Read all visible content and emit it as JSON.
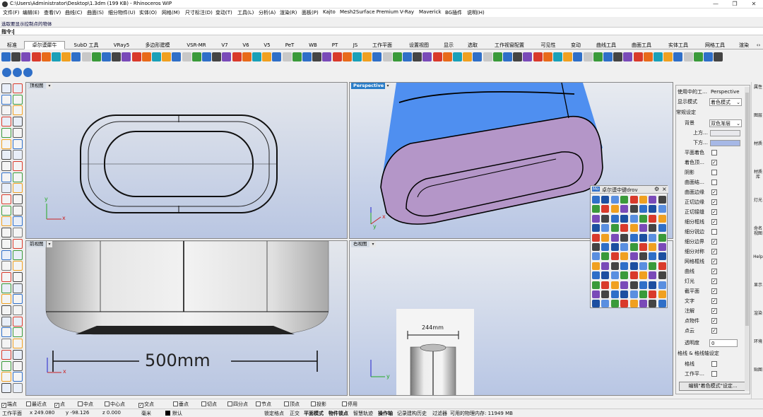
{
  "window": {
    "title": "C:\\Users\\Administrator\\Desktop\\1.3dm (199 KB) - Rhinoceros WIP",
    "minimize": "—",
    "maximize": "❐",
    "close": "✕"
  },
  "menu": [
    "文件(F)",
    "编辑(E)",
    "查看(V)",
    "曲线(C)",
    "曲面(S)",
    "细分物件(U)",
    "实体(O)",
    "网格(M)",
    "尺寸标注(D)",
    "变动(T)",
    "工具(L)",
    "分析(A)",
    "渲染(R)",
    "面板(P)",
    "Kajto",
    "Mesh2Surface Premium",
    "V-Ray",
    "Maverick",
    "BG插件",
    "说明(H)"
  ],
  "command": {
    "history": "选取要显示控制点的物体",
    "prompt": "指令:"
  },
  "tabs": [
    {
      "label": "标准",
      "active": false
    },
    {
      "label": "卓尔谟犀牛",
      "active": true
    },
    {
      "label": "SubD 工具",
      "active": false
    },
    {
      "label": "VRay5",
      "active": false
    },
    {
      "label": "多边形建模",
      "active": false
    },
    {
      "label": "VSR-MR",
      "active": false
    },
    {
      "label": "V7",
      "active": false
    },
    {
      "label": "V6",
      "active": false
    },
    {
      "label": "V5",
      "active": false
    },
    {
      "label": "PeT",
      "active": false
    },
    {
      "label": "WB",
      "active": false
    },
    {
      "label": "PT",
      "active": false
    },
    {
      "label": "JS",
      "active": false
    },
    {
      "label": "工作平面",
      "active": false
    },
    {
      "label": "设置视图",
      "active": false
    },
    {
      "label": "显示",
      "active": false
    },
    {
      "label": "选取",
      "active": false
    },
    {
      "label": "工作视窗配置",
      "active": false
    },
    {
      "label": "可见性",
      "active": false
    },
    {
      "label": "变动",
      "active": false
    },
    {
      "label": "曲线工具",
      "active": false
    },
    {
      "label": "曲面工具",
      "active": false
    },
    {
      "label": "实体工具",
      "active": false
    },
    {
      "label": "网格工具",
      "active": false
    },
    {
      "label": "渲染",
      "active": false
    }
  ],
  "viewports": {
    "top": {
      "label": "顶视图",
      "menu": "▾"
    },
    "perspective": {
      "label": "Perspective",
      "menu": "▾"
    },
    "front": {
      "label": "前视图",
      "menu": "▾",
      "dimension": "500mm"
    },
    "right": {
      "label": "右视图",
      "menu": "▾",
      "dimension": "244mm"
    }
  },
  "axes": {
    "x": "x",
    "y": "y"
  },
  "float_panel": {
    "title": "卓尔谟中键drov",
    "gear": "⚙",
    "close": "×",
    "logo": "Mo"
  },
  "display_panel": {
    "current_label": "使用中的工…",
    "current_value": "Perspective",
    "mode_label": "显示模式",
    "mode_value": "着色模式",
    "section_general": "常规设定",
    "bg_label": "背景",
    "bg_value": "双色渐层",
    "top_label": "上方…",
    "bottom_label": "下方…",
    "options": [
      {
        "label": "平面着色",
        "checked": false
      },
      {
        "label": "着色顶…",
        "checked": true
      },
      {
        "label": "阴影",
        "checked": false
      },
      {
        "label": "曲面结…",
        "checked": false
      },
      {
        "label": "曲面边缘",
        "checked": true
      },
      {
        "label": "正切边缘",
        "checked": true
      },
      {
        "label": "正切接缝",
        "checked": true
      },
      {
        "label": "细分框线",
        "checked": true
      },
      {
        "label": "细分锐边",
        "checked": false
      },
      {
        "label": "细分边界",
        "checked": true
      },
      {
        "label": "细分对称",
        "checked": true
      },
      {
        "label": "网格框线",
        "checked": true
      },
      {
        "label": "曲线",
        "checked": true
      },
      {
        "label": "灯光",
        "checked": true
      },
      {
        "label": "截平面",
        "checked": true
      },
      {
        "label": "文字",
        "checked": true
      },
      {
        "label": "注解",
        "checked": true
      },
      {
        "label": "点物件",
        "checked": true
      },
      {
        "label": "点云",
        "checked": true
      }
    ],
    "transparency_label": "透明度",
    "transparency_value": "0",
    "section_grid": "格线 & 格线轴设定",
    "grid_rows": [
      {
        "label": "格线",
        "checked": false
      },
      {
        "label": "工作平…",
        "checked": false
      }
    ],
    "edit_button": "编辑\"着色模式\"设定..."
  },
  "right_tabs": [
    "属性",
    "图层",
    "材质",
    "材质库",
    "灯光",
    "命名视图",
    "Help",
    "显示",
    "渲染",
    "环境",
    "贴图"
  ],
  "osnaps": [
    {
      "label": "端点",
      "checked": true
    },
    {
      "label": "最近点",
      "checked": false
    },
    {
      "label": "点",
      "checked": true
    },
    {
      "label": "中点",
      "checked": false
    },
    {
      "label": "中心点",
      "checked": false
    },
    {
      "label": "交点",
      "checked": true
    },
    {
      "label": "垂点",
      "checked": false
    },
    {
      "label": "切点",
      "checked": false
    },
    {
      "label": "四分点",
      "checked": false
    },
    {
      "label": "节点",
      "checked": false
    },
    {
      "label": "顶点",
      "checked": false
    },
    {
      "label": "投影",
      "checked": false
    },
    {
      "label": "停用",
      "checked": false
    }
  ],
  "status": {
    "cplane": "工作平面",
    "x": "x 249.080",
    "y": "y -98.126",
    "z": "z 0.000",
    "unit": "毫米",
    "layer": "默认",
    "modes": [
      "锁定格点",
      "正交",
      "平面模式",
      "物件锁点",
      "智慧轨迹",
      "操作轴",
      "记录建构历史",
      "过滤器"
    ],
    "memory": "可用的物理内存: 11949 MB"
  }
}
